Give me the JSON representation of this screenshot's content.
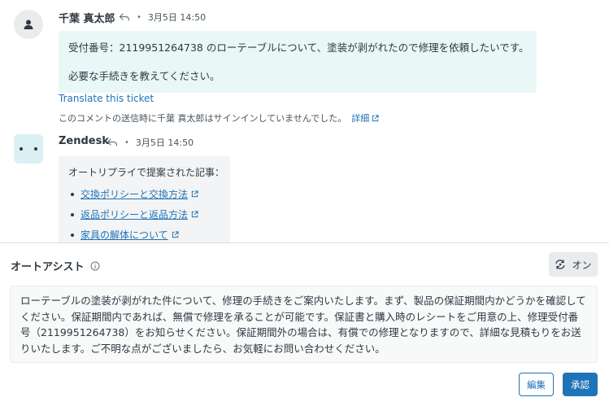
{
  "thread": {
    "user_comment": {
      "author": "千葉 真太郎",
      "timestamp": "3月5日 14:50",
      "body_line1": "受付番号：2119951264738 のローテーブルについて、塗装が剥がれたので修理を依頼したいです。",
      "body_line2": "必要な手続きを教えてください。",
      "translate_link": "Translate this ticket",
      "not_signed_in_notice": "このコメントの送信時に千葉 真太郎はサインインしていませんでした。",
      "details_link": "詳細"
    },
    "bot_comment": {
      "author": "Zendesk",
      "timestamp": "3月5日 14:50",
      "intro": "オートリプライで提案された記事：",
      "articles": [
        {
          "title": "交換ポリシーと交換方法"
        },
        {
          "title": "返品ポリシーと返品方法"
        },
        {
          "title": "家具の解体について"
        }
      ]
    }
  },
  "auto_assist": {
    "title": "オートアシスト",
    "toggle_label": "オン",
    "suggestion": "ローテーブルの塗装が剥がれた件について、修理の手続きをご案内いたします。まず、製品の保証期間内かどうかを確認してください。保証期間内であれば、無償で修理を承ることが可能です。保証書と購入時のレシートをご用意の上、修理受付番号（2119951264738）をお知らせください。保証期間外の場合は、有償での修理となりますので、詳細な見積もりをお送りいたします。ご不明な点がございましたら、お気軽にお問い合わせください。",
    "edit_label": "編集",
    "approve_label": "承認"
  },
  "icons": {
    "user_avatar": "person-icon",
    "bot_avatar": "bot-face-icon",
    "reply": "reply-icon",
    "external_link": "external-link-icon",
    "info": "info-icon",
    "toggle": "auto-assist-icon"
  },
  "colors": {
    "accent": "#1f73b7",
    "user_bubble": "#e9f7f6",
    "bot_bubble": "#f3f4f5",
    "bot_avatar": "#daf0f4"
  }
}
